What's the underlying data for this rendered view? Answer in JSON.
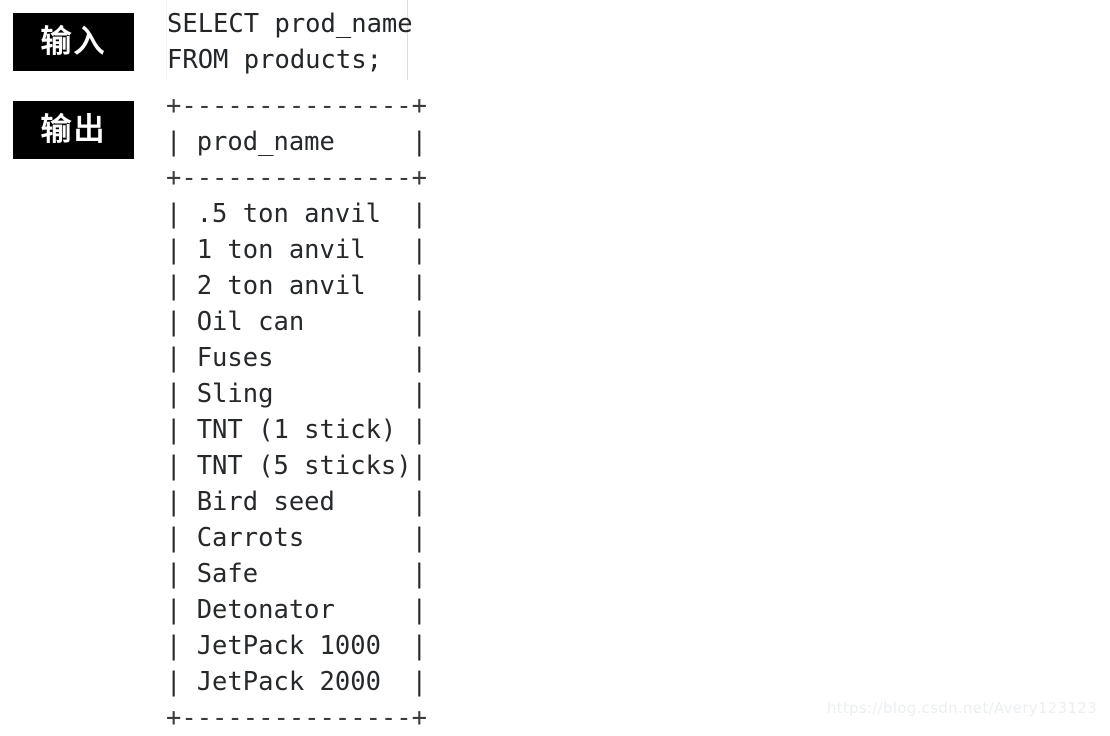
{
  "labels": {
    "input": "输入",
    "output": "输出"
  },
  "sql": {
    "line1": "SELECT prod_name",
    "line2": "FROM products;"
  },
  "result_table": {
    "top_rule": "+---------------+",
    "header_row": "| prod_name     |",
    "header_rule": "+---------------+",
    "bottom_rule": "+---------------+",
    "column_header": "prod_name",
    "rows": [
      "| .5 ton anvil  |",
      "| 1 ton anvil   |",
      "| 2 ton anvil   |",
      "| Oil can       |",
      "| Fuses         |",
      "| Sling         |",
      "| TNT (1 stick) |",
      "| TNT (5 sticks)|",
      "| Bird seed     |",
      "| Carrots       |",
      "| Safe          |",
      "| Detonator     |",
      "| JetPack 1000  |",
      "| JetPack 2000  |"
    ],
    "values": [
      ".5 ton anvil",
      "1 ton anvil",
      "2 ton anvil",
      "Oil can",
      "Fuses",
      "Sling",
      "TNT (1 stick)",
      "TNT (5 sticks)",
      "Bird seed",
      "Carrots",
      "Safe",
      "Detonator",
      "JetPack 1000",
      "JetPack 2000"
    ],
    "row_count": 14
  },
  "watermark": {
    "text": "https://blog.csdn.net/Avery123123"
  },
  "colors": {
    "background": "#ffffff",
    "text": "#26292b",
    "label_background": "#000000",
    "label_text": "#ffffff",
    "watermark_text": "#eceff1"
  }
}
